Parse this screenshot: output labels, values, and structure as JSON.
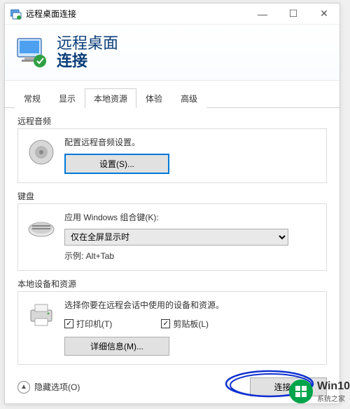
{
  "window": {
    "title": "远程桌面连接"
  },
  "header": {
    "line1": "远程桌面",
    "line2": "连接"
  },
  "tabs": [
    {
      "label": "常规",
      "active": false
    },
    {
      "label": "显示",
      "active": false
    },
    {
      "label": "本地资源",
      "active": true
    },
    {
      "label": "体验",
      "active": false
    },
    {
      "label": "高级",
      "active": false
    }
  ],
  "audio": {
    "group_title": "远程音频",
    "desc": "配置远程音频设置。",
    "settings_btn": "设置(S)..."
  },
  "keyboard": {
    "group_title": "键盘",
    "label": "应用 Windows 组合键(K):",
    "selected": "仅在全屏显示时",
    "example": "示例: Alt+Tab"
  },
  "devices": {
    "group_title": "本地设备和资源",
    "desc": "选择你要在远程会话中使用的设备和资源。",
    "printer_label": "打印机(T)",
    "clipboard_label": "剪贴板(L)",
    "details_btn": "详细信息(M)..."
  },
  "footer": {
    "hide_options": "隐藏选项(O)",
    "connect_btn": "连接(N)"
  },
  "watermark": {
    "brand": "Win10",
    "sub": "系统之家"
  }
}
